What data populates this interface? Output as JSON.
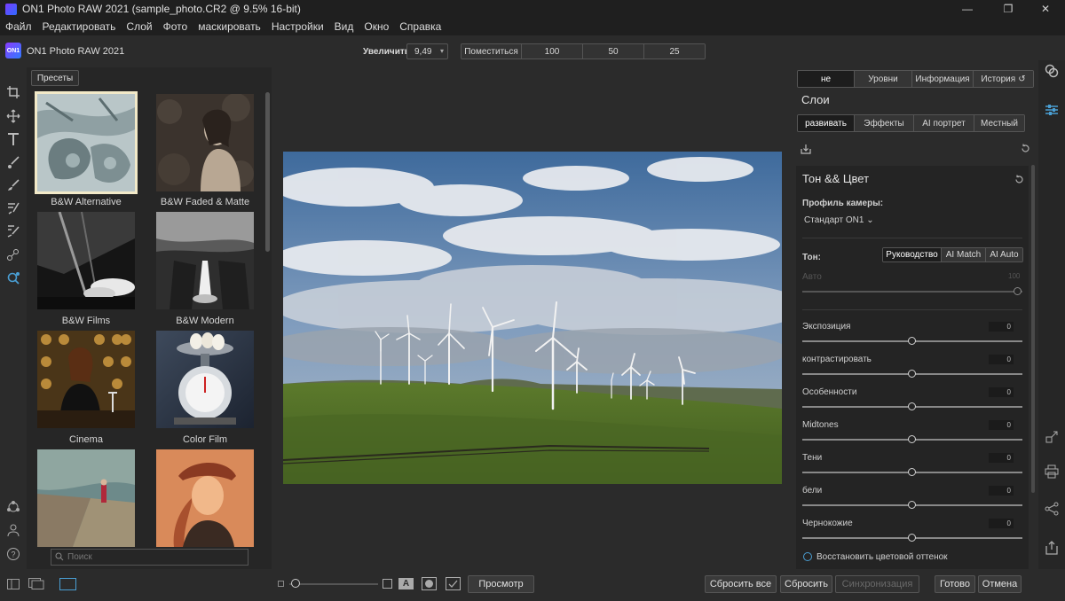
{
  "window": {
    "title": "ON1 Photo RAW 2021 (sample_photo.CR2 @ 9.5% 16-bit)",
    "minimize_glyph": "—",
    "maximize_glyph": "❐",
    "close_glyph": "✕"
  },
  "menu": [
    "Файл",
    "Редактировать",
    "Слой",
    "Фото",
    "маскировать",
    "Настройки",
    "Вид",
    "Окно",
    "Справка"
  ],
  "toolbar": {
    "logo_text": "ON1",
    "app_name": "ON1 Photo RAW 2021",
    "zoom_label": "Увеличить",
    "zoom_value": "9,49",
    "zoom_buttons": [
      "Поместиться",
      "100",
      "50",
      "25"
    ]
  },
  "presets": {
    "tab_label": "Пресеты",
    "items": [
      {
        "label": "B&W Alternative",
        "selected": true
      },
      {
        "label": "B&W Faded & Matte"
      },
      {
        "label": "B&W Films"
      },
      {
        "label": "B&W Modern"
      },
      {
        "label": "Cinema"
      },
      {
        "label": "Color Film"
      },
      {
        "label": ""
      },
      {
        "label": ""
      }
    ],
    "search_placeholder": "Поиск"
  },
  "right_panel": {
    "top_tabs": [
      "не",
      "Уровни",
      "Информация",
      "История"
    ],
    "history_icon": "↺",
    "layers_title": "Слои",
    "module_tabs": [
      "развивать",
      "Эффекты",
      "AI портрет",
      "Местный"
    ],
    "section_title": "Тон && Цвет",
    "camera_profile_label": "Профиль камеры:",
    "camera_profile_value": "Стандарт ON1",
    "tone_label": "Тон:",
    "tone_modes": [
      "Руководство",
      "AI Match",
      "AI Auto"
    ],
    "auto_label": "Авто",
    "auto_value": "100",
    "sliders": [
      {
        "label": "Экспозиция",
        "value": "0"
      },
      {
        "label": "контрастировать",
        "value": "0"
      },
      {
        "label": "Особенности",
        "value": "0"
      },
      {
        "label": "Midtones",
        "value": "0"
      },
      {
        "label": "Тени",
        "value": "0"
      },
      {
        "label": "бели",
        "value": "0"
      },
      {
        "label": "Чернокожие",
        "value": "0"
      }
    ],
    "restore_label": "Восстановить цветовой оттенок"
  },
  "bottom": {
    "preview_label": "Просмотр",
    "reset_all": "Сбросить все",
    "reset": "Сбросить",
    "sync": "Синхронизация",
    "done": "Готово",
    "cancel": "Отмена",
    "text_toggle": "A"
  },
  "colors": {
    "accent": "#4a9fd4",
    "panel": "#2b2b2b",
    "selected_preset_border": "#f2e9c8"
  }
}
